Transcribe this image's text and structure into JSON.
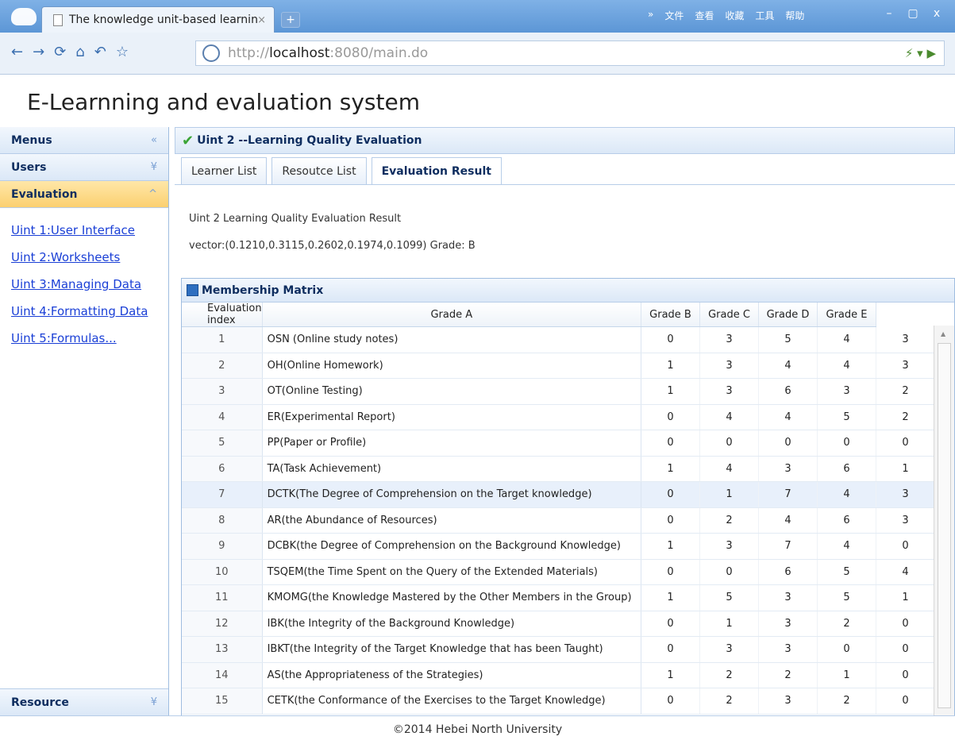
{
  "browser": {
    "tab_title": "The knowledge unit-based learnin",
    "tab_close": "×",
    "new_tab": "+",
    "sys_menu": [
      "»",
      "文件",
      "查看",
      "收藏",
      "工具",
      "帮助"
    ],
    "window_buttons": [
      "–",
      "▢",
      "x"
    ],
    "nav_icons": [
      "←",
      "→",
      "⟳",
      "⌂",
      "↶",
      "☆"
    ],
    "url_prefix": "http://",
    "url_host": "localhost",
    "url_rest": ":8080/main.do",
    "address_right_icons": "⚡ ▾ ▶"
  },
  "app": {
    "title": "E-Learnning and evaluation system",
    "footer": "©2014 Hebei North University"
  },
  "sidebar": {
    "menus": "Menus",
    "users": "Users",
    "evaluation": "Evaluation",
    "resource": "Resource",
    "links": [
      "Uint 1:User Interface",
      "Uint 2:Worksheets",
      "Uint 3:Managing Data",
      "Uint 4:Formatting Data",
      "Uint 5:Formulas..."
    ]
  },
  "main": {
    "panel_title": "Uint 2 --Learning Quality Evaluation",
    "tabs": [
      "Learner List",
      "Resoutce List",
      "Evaluation Result"
    ],
    "result_title": "Uint 2 Learning Quality Evaluation Result",
    "result_vector": "vector:(0.1210,0.3115,0.2602,0.1974,0.1099) Grade: B",
    "matrix_title": "Membership Matrix",
    "columns": [
      "Evaluation index",
      "Grade A",
      "Grade B",
      "Grade C",
      "Grade D",
      "Grade E"
    ],
    "rows": [
      {
        "n": "1",
        "name": "OSN (Online study notes)",
        "g": [
          "0",
          "3",
          "5",
          "4",
          "3"
        ]
      },
      {
        "n": "2",
        "name": "OH(Online Homework)",
        "g": [
          "1",
          "3",
          "4",
          "4",
          "3"
        ]
      },
      {
        "n": "3",
        "name": "OT(Online Testing)",
        "g": [
          "1",
          "3",
          "6",
          "3",
          "2"
        ]
      },
      {
        "n": "4",
        "name": "ER(Experimental Report)",
        "g": [
          "0",
          "4",
          "4",
          "5",
          "2"
        ]
      },
      {
        "n": "5",
        "name": "PP(Paper or Profile)",
        "g": [
          "0",
          "0",
          "0",
          "0",
          "0"
        ]
      },
      {
        "n": "6",
        "name": "TA(Task Achievement)",
        "g": [
          "1",
          "4",
          "3",
          "6",
          "1"
        ]
      },
      {
        "n": "7",
        "name": "DCTK(The Degree of Comprehension on the Target knowledge)",
        "g": [
          "0",
          "1",
          "7",
          "4",
          "3"
        ]
      },
      {
        "n": "8",
        "name": "AR(the Abundance of Resources)",
        "g": [
          "0",
          "2",
          "4",
          "6",
          "3"
        ]
      },
      {
        "n": "9",
        "name": "DCBK(the Degree of Comprehension on the Background Knowledge)",
        "g": [
          "1",
          "3",
          "7",
          "4",
          "0"
        ]
      },
      {
        "n": "10",
        "name": "TSQEM(the Time Spent on the Query of the Extended Materials)",
        "g": [
          "0",
          "0",
          "6",
          "5",
          "4"
        ]
      },
      {
        "n": "11",
        "name": "KMOMG(the Knowledge Mastered by the Other Members in the Group)",
        "g": [
          "1",
          "5",
          "3",
          "5",
          "1"
        ]
      },
      {
        "n": "12",
        "name": "IBK(the Integrity of the Background Knowledge)",
        "g": [
          "0",
          "1",
          "3",
          "2",
          "0"
        ]
      },
      {
        "n": "13",
        "name": "IBKT(the Integrity of the Target Knowledge that has been Taught)",
        "g": [
          "0",
          "3",
          "3",
          "0",
          "0"
        ]
      },
      {
        "n": "14",
        "name": "AS(the Appropriateness of the Strategies)",
        "g": [
          "1",
          "2",
          "2",
          "1",
          "0"
        ]
      },
      {
        "n": "15",
        "name": "CETK(the Conformance of the Exercises to the Target Knowledge)",
        "g": [
          "0",
          "2",
          "3",
          "2",
          "0"
        ]
      }
    ]
  }
}
